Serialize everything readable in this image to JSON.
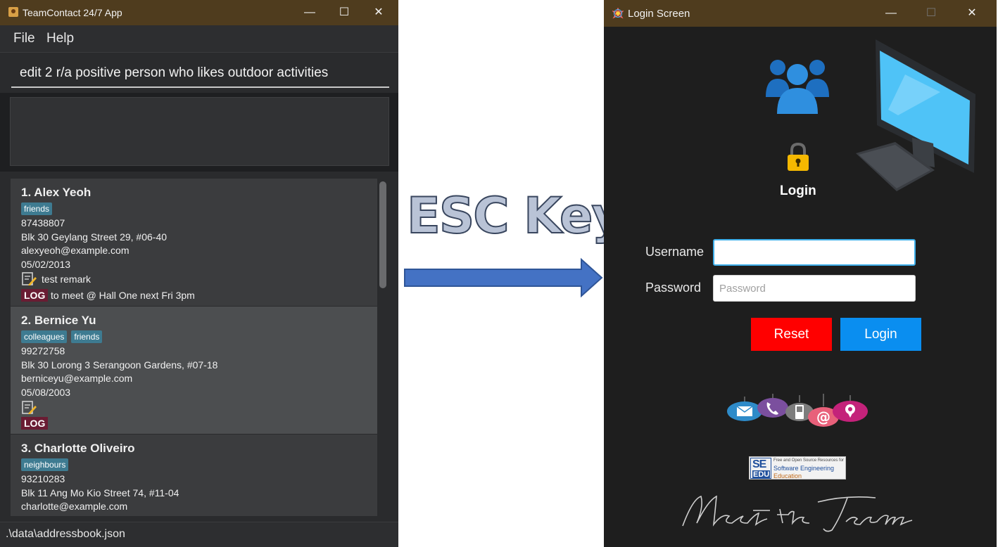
{
  "left_window": {
    "title": "TeamContact 24/7 App",
    "controls": {
      "minimize": "—",
      "maximize": "☐",
      "close": "✕"
    },
    "menu": [
      "File",
      "Help"
    ],
    "command": {
      "value": "edit 2 r/a positive person who likes outdoor activities"
    },
    "persons": [
      {
        "name": "1.  Alex Yeoh",
        "tags": [
          "friends"
        ],
        "phone": "87438807",
        "address": "Blk 30 Geylang Street 29, #06-40",
        "email": "alexyeoh@example.com",
        "date": "05/02/2013",
        "remark": "test remark",
        "log_badge": "LOG",
        "log": "to meet @ Hall One next Fri 3pm"
      },
      {
        "name": "2.  Bernice Yu",
        "tags": [
          "colleagues",
          "friends"
        ],
        "phone": "99272758",
        "address": "Blk 30 Lorong 3 Serangoon Gardens, #07-18",
        "email": "berniceyu@example.com",
        "date": "05/08/2003",
        "remark": "",
        "log_badge": "LOG",
        "log": ""
      },
      {
        "name": "3.  Charlotte Oliveiro",
        "tags": [
          "neighbours"
        ],
        "phone": "93210283",
        "address": "Blk 11 Ang Mo Kio Street 74, #11-04",
        "email": "charlotte@example.com"
      }
    ],
    "status_path": ".\\data\\addressbook.json"
  },
  "center": {
    "label": "ESC Key",
    "arrow_color": "#4472c4"
  },
  "right_window": {
    "title": "Login Screen",
    "controls": {
      "minimize": "—",
      "maximize": "☐",
      "close": "✕"
    },
    "icons": [
      "team-icon",
      "padlock-icon",
      "monitor-icon",
      "contact-methods-icon"
    ],
    "heading": "Login",
    "username_label": "Username",
    "username_value": "",
    "password_label": "Password",
    "password_placeholder": "Password",
    "reset_label": "Reset",
    "login_label": "Login",
    "se_logo": {
      "top": "SE",
      "bottom": "EDU",
      "line1": "Free and Open Source Resources for",
      "line2": "Software Engineering",
      "line3": "Education"
    },
    "signature": "Meet the Team",
    "colors": {
      "reset": "#ff0000",
      "login": "#0a8ef0",
      "titlebar": "#4f3c1e"
    }
  }
}
